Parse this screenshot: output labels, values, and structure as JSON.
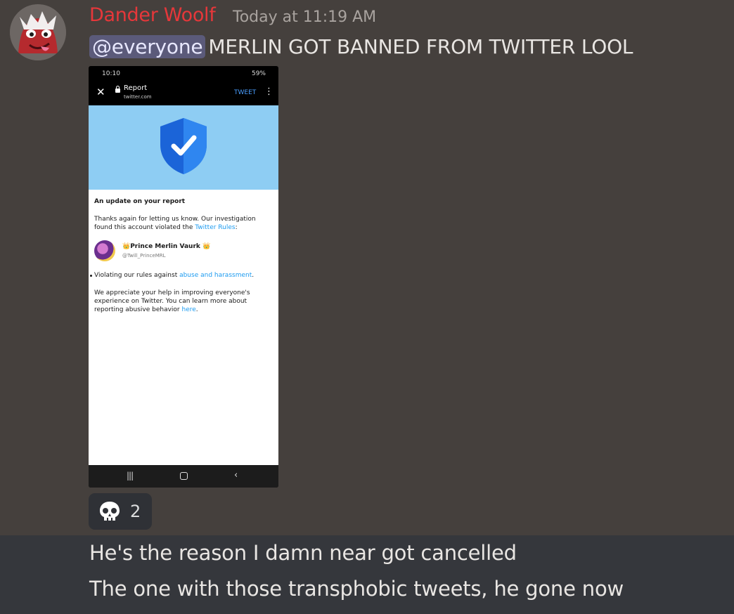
{
  "message": {
    "author": "Dander Woolf",
    "timestamp": "Today at 11:19 AM",
    "mention": "@everyone",
    "text": "MERLIN GOT BANNED FROM TWITTER LOOL"
  },
  "screenshot": {
    "status_time": "10:10",
    "status_battery": "59%",
    "page_title": "Report",
    "page_domain": "twitter.com",
    "tweet_button": "TWEET",
    "heading": "An update on your report",
    "para1_a": "Thanks again for letting us know. Our investigation found this account violated the ",
    "para1_link": "Twitter Rules",
    "para1_b": ":",
    "account_name": "👑Prince Merlin Vaurk 👑",
    "account_handle": "@Twill_PrinceMRL",
    "bullet_a": "Violating our rules against ",
    "bullet_link": "abuse and harassment",
    "bullet_b": ".",
    "para2_a": "We appreciate your help in improving everyone's experience on Twitter. You can learn more about reporting abusive behavior ",
    "para2_link": "here",
    "para2_b": "."
  },
  "reaction": {
    "emoji": "skull",
    "count": "2"
  },
  "followups": [
    "He's the reason I damn near got cancelled",
    "The one with those transphobic tweets, he gone now"
  ],
  "colors": {
    "background": "#45403d",
    "author": "#e6373a",
    "mention_bg": "#5b5a7a",
    "hover_bg": "#35373c",
    "link": "#1d9bf0"
  }
}
